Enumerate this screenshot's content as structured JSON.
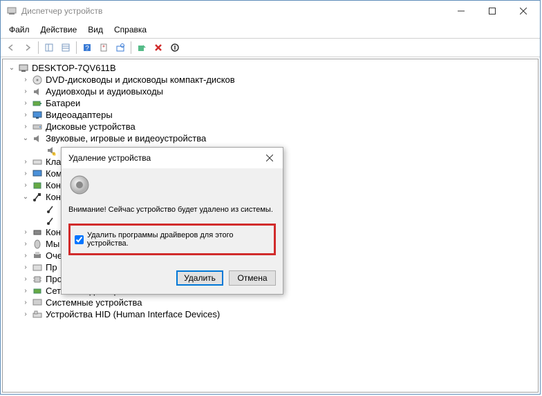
{
  "window": {
    "title": "Диспетчер устройств"
  },
  "menu": {
    "file": "Файл",
    "action": "Действие",
    "view": "Вид",
    "help": "Справка"
  },
  "tree": {
    "root": "DESKTOP-7QV611B",
    "items": [
      "DVD-дисководы и дисководы компакт-дисков",
      "Аудиовходы и аудиовыходы",
      "Батареи",
      "Видеоадаптеры",
      "Дисковые устройства",
      "Звуковые, игровые и видеоустройства",
      "Кла",
      "Ком",
      "Кон",
      "Кон",
      "Кон",
      "Мы",
      "Оче",
      "Пр",
      "Процессоры",
      "Сетевые адаптеры",
      "Системные устройства",
      "Устройства HID (Human Interface Devices)"
    ]
  },
  "dialog": {
    "title": "Удаление устройства",
    "message": "Внимание! Сейчас устройство будет удалено из системы.",
    "checkbox_label": "Удалить программы драйверов для этого устройства.",
    "checkbox_checked": true,
    "ok": "Удалить",
    "cancel": "Отмена"
  }
}
